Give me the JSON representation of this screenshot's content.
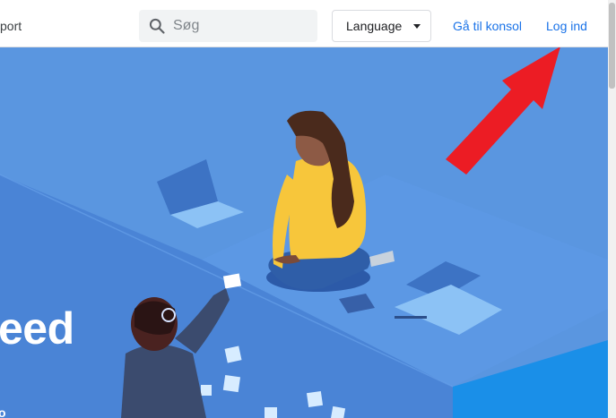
{
  "header": {
    "brand_fragment": "port",
    "search": {
      "placeholder": "Søg",
      "icon": "search-icon"
    },
    "language_button": {
      "label": "Language",
      "icon": "caret-down-icon"
    },
    "console_link": "Gå til konsol",
    "signin_link": "Log ind"
  },
  "hero": {
    "headline_fragment": "eed",
    "subline_fragment": "o"
  },
  "annotation": {
    "type": "arrow",
    "color": "#ec1c24",
    "points_to": "signin_link"
  },
  "colors": {
    "hero_bg": "#5a96e0",
    "link": "#1a73e8",
    "person_shirt": "#f7c63b"
  }
}
